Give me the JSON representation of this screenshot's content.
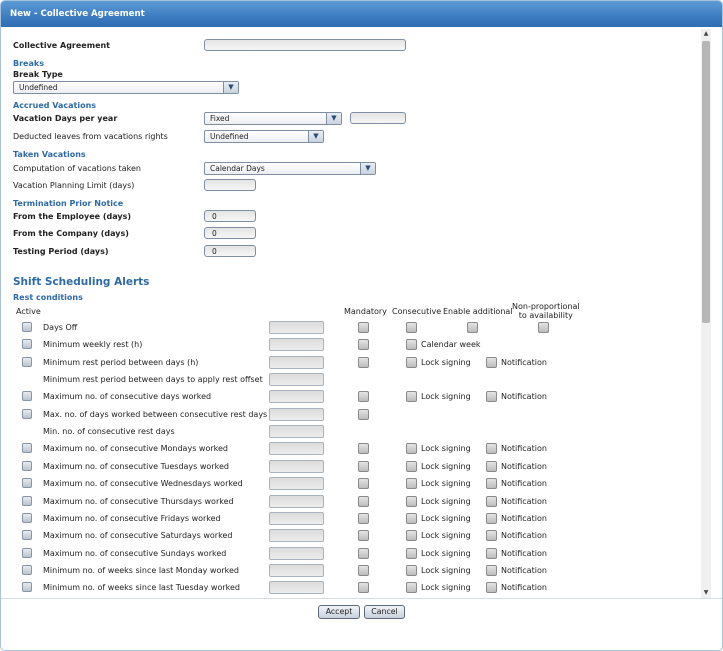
{
  "window": {
    "title": "New - Collective Agreement"
  },
  "form": {
    "collective_agreement_label": "Collective Agreement",
    "collective_agreement_value": "",
    "breaks": {
      "section": "Breaks",
      "break_type_label": "Break Type",
      "break_type_value": "Undefined"
    },
    "accrued": {
      "section": "Accrued Vacations",
      "vacation_days_label": "Vacation Days per year",
      "vacation_days_value": "Fixed",
      "vacation_days_extra": "",
      "deducted_label": "Deducted leaves from vacations rights",
      "deducted_value": "Undefined"
    },
    "taken": {
      "section": "Taken Vacations",
      "computation_label": "Computation of vacations taken",
      "computation_value": "Calendar Days",
      "planning_limit_label": "Vacation Planning Limit (days)",
      "planning_limit_value": ""
    },
    "termination": {
      "section": "Termination Prior Notice",
      "from_employee_label": "From the Employee (days)",
      "from_employee_value": "0",
      "from_company_label": "From the Company (days)",
      "from_company_value": "0",
      "testing_label": "Testing Period (days)",
      "testing_value": "0"
    }
  },
  "alerts": {
    "title": "Shift Scheduling Alerts",
    "rest_title": "Rest conditions",
    "headers": {
      "active": "Active",
      "mandatory": "Mandatory",
      "consecutive": "Consecutive",
      "enable_additional": "Enable additional",
      "nonprop_line1": "Non-proportional",
      "nonprop_line2": "to availability"
    },
    "rows": [
      {
        "label": "Days Off",
        "active": true,
        "mandatory": true,
        "opt1": "",
        "opt2": "",
        "consecutive": true,
        "enable_additional": true,
        "nonprop": true
      },
      {
        "label": "Minimum weekly rest (h)",
        "active": true,
        "mandatory": true,
        "opt1": "Calendar week",
        "opt2": ""
      },
      {
        "label": "Minimum rest period between days (h)",
        "active": true,
        "mandatory": true,
        "opt1": "Lock signing",
        "opt2": "Notification"
      },
      {
        "label": "Minimum rest period between days to apply rest offset",
        "active": false,
        "mandatory": false,
        "opt1": "",
        "opt2": ""
      },
      {
        "label": "Maximum no. of consecutive days worked",
        "active": true,
        "mandatory": true,
        "opt1": "Lock signing",
        "opt2": "Notification"
      },
      {
        "label": "Max. no. of days worked between consecutive rest days",
        "active": true,
        "mandatory": true,
        "opt1": "",
        "opt2": ""
      },
      {
        "label": "Min. no. of consecutive rest days",
        "active": false,
        "mandatory": false,
        "opt1": "",
        "opt2": ""
      },
      {
        "label": "Maximum no. of consecutive Mondays worked",
        "active": true,
        "mandatory": true,
        "opt1": "Lock signing",
        "opt2": "Notification"
      },
      {
        "label": "Maximum no. of consecutive Tuesdays worked",
        "active": true,
        "mandatory": true,
        "opt1": "Lock signing",
        "opt2": "Notification"
      },
      {
        "label": "Maximum no. of consecutive Wednesdays worked",
        "active": true,
        "mandatory": true,
        "opt1": "Lock signing",
        "opt2": "Notification"
      },
      {
        "label": "Maximum no. of consecutive Thursdays worked",
        "active": true,
        "mandatory": true,
        "opt1": "Lock signing",
        "opt2": "Notification"
      },
      {
        "label": "Maximum no. of consecutive Fridays worked",
        "active": true,
        "mandatory": true,
        "opt1": "Lock signing",
        "opt2": "Notification"
      },
      {
        "label": "Maximum no. of consecutive Saturdays worked",
        "active": true,
        "mandatory": true,
        "opt1": "Lock signing",
        "opt2": "Notification"
      },
      {
        "label": "Maximum no. of consecutive Sundays worked",
        "active": true,
        "mandatory": true,
        "opt1": "Lock signing",
        "opt2": "Notification"
      },
      {
        "label": "Minimum no. of weeks since last Monday worked",
        "active": true,
        "mandatory": true,
        "opt1": "Lock signing",
        "opt2": "Notification"
      },
      {
        "label": "Minimum no. of weeks since last Tuesday worked",
        "active": true,
        "mandatory": true,
        "opt1": "Lock signing",
        "opt2": "Notification"
      }
    ]
  },
  "buttons": {
    "accept": "Accept",
    "cancel": "Cancel"
  },
  "icons": {
    "dropdown": "chevron-down-icon",
    "scroll_up": "arrow-up-icon",
    "scroll_down": "arrow-down-icon"
  },
  "colors": {
    "title_bar": "#3e7cc2",
    "section_text": "#2e6aa8"
  }
}
